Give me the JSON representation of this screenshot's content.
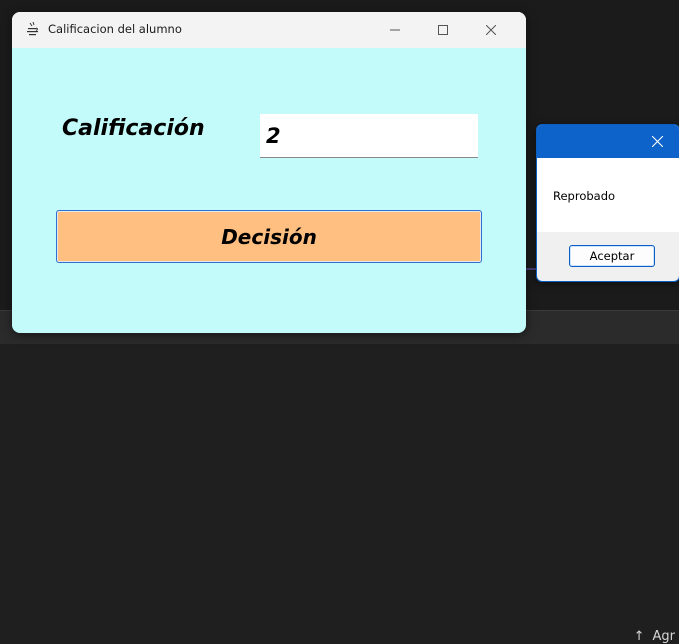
{
  "main_window": {
    "title": "Calificacion del alumno",
    "grade_label": "Calificación",
    "grade_value": "2",
    "decision_button_label": "Decisión",
    "background_color": "#c3fbfb",
    "button_color": "#ffbf80"
  },
  "dialog": {
    "message": "Reprobado",
    "ok_label": "Aceptar",
    "titlebar_color": "#0d63c9"
  },
  "background": {
    "hint_text": "Agr"
  },
  "icons": {
    "app_icon": "java-cup-icon",
    "minimize": "minimize-icon",
    "maximize": "maximize-icon",
    "close": "close-icon",
    "upload": "arrow-up-icon"
  }
}
